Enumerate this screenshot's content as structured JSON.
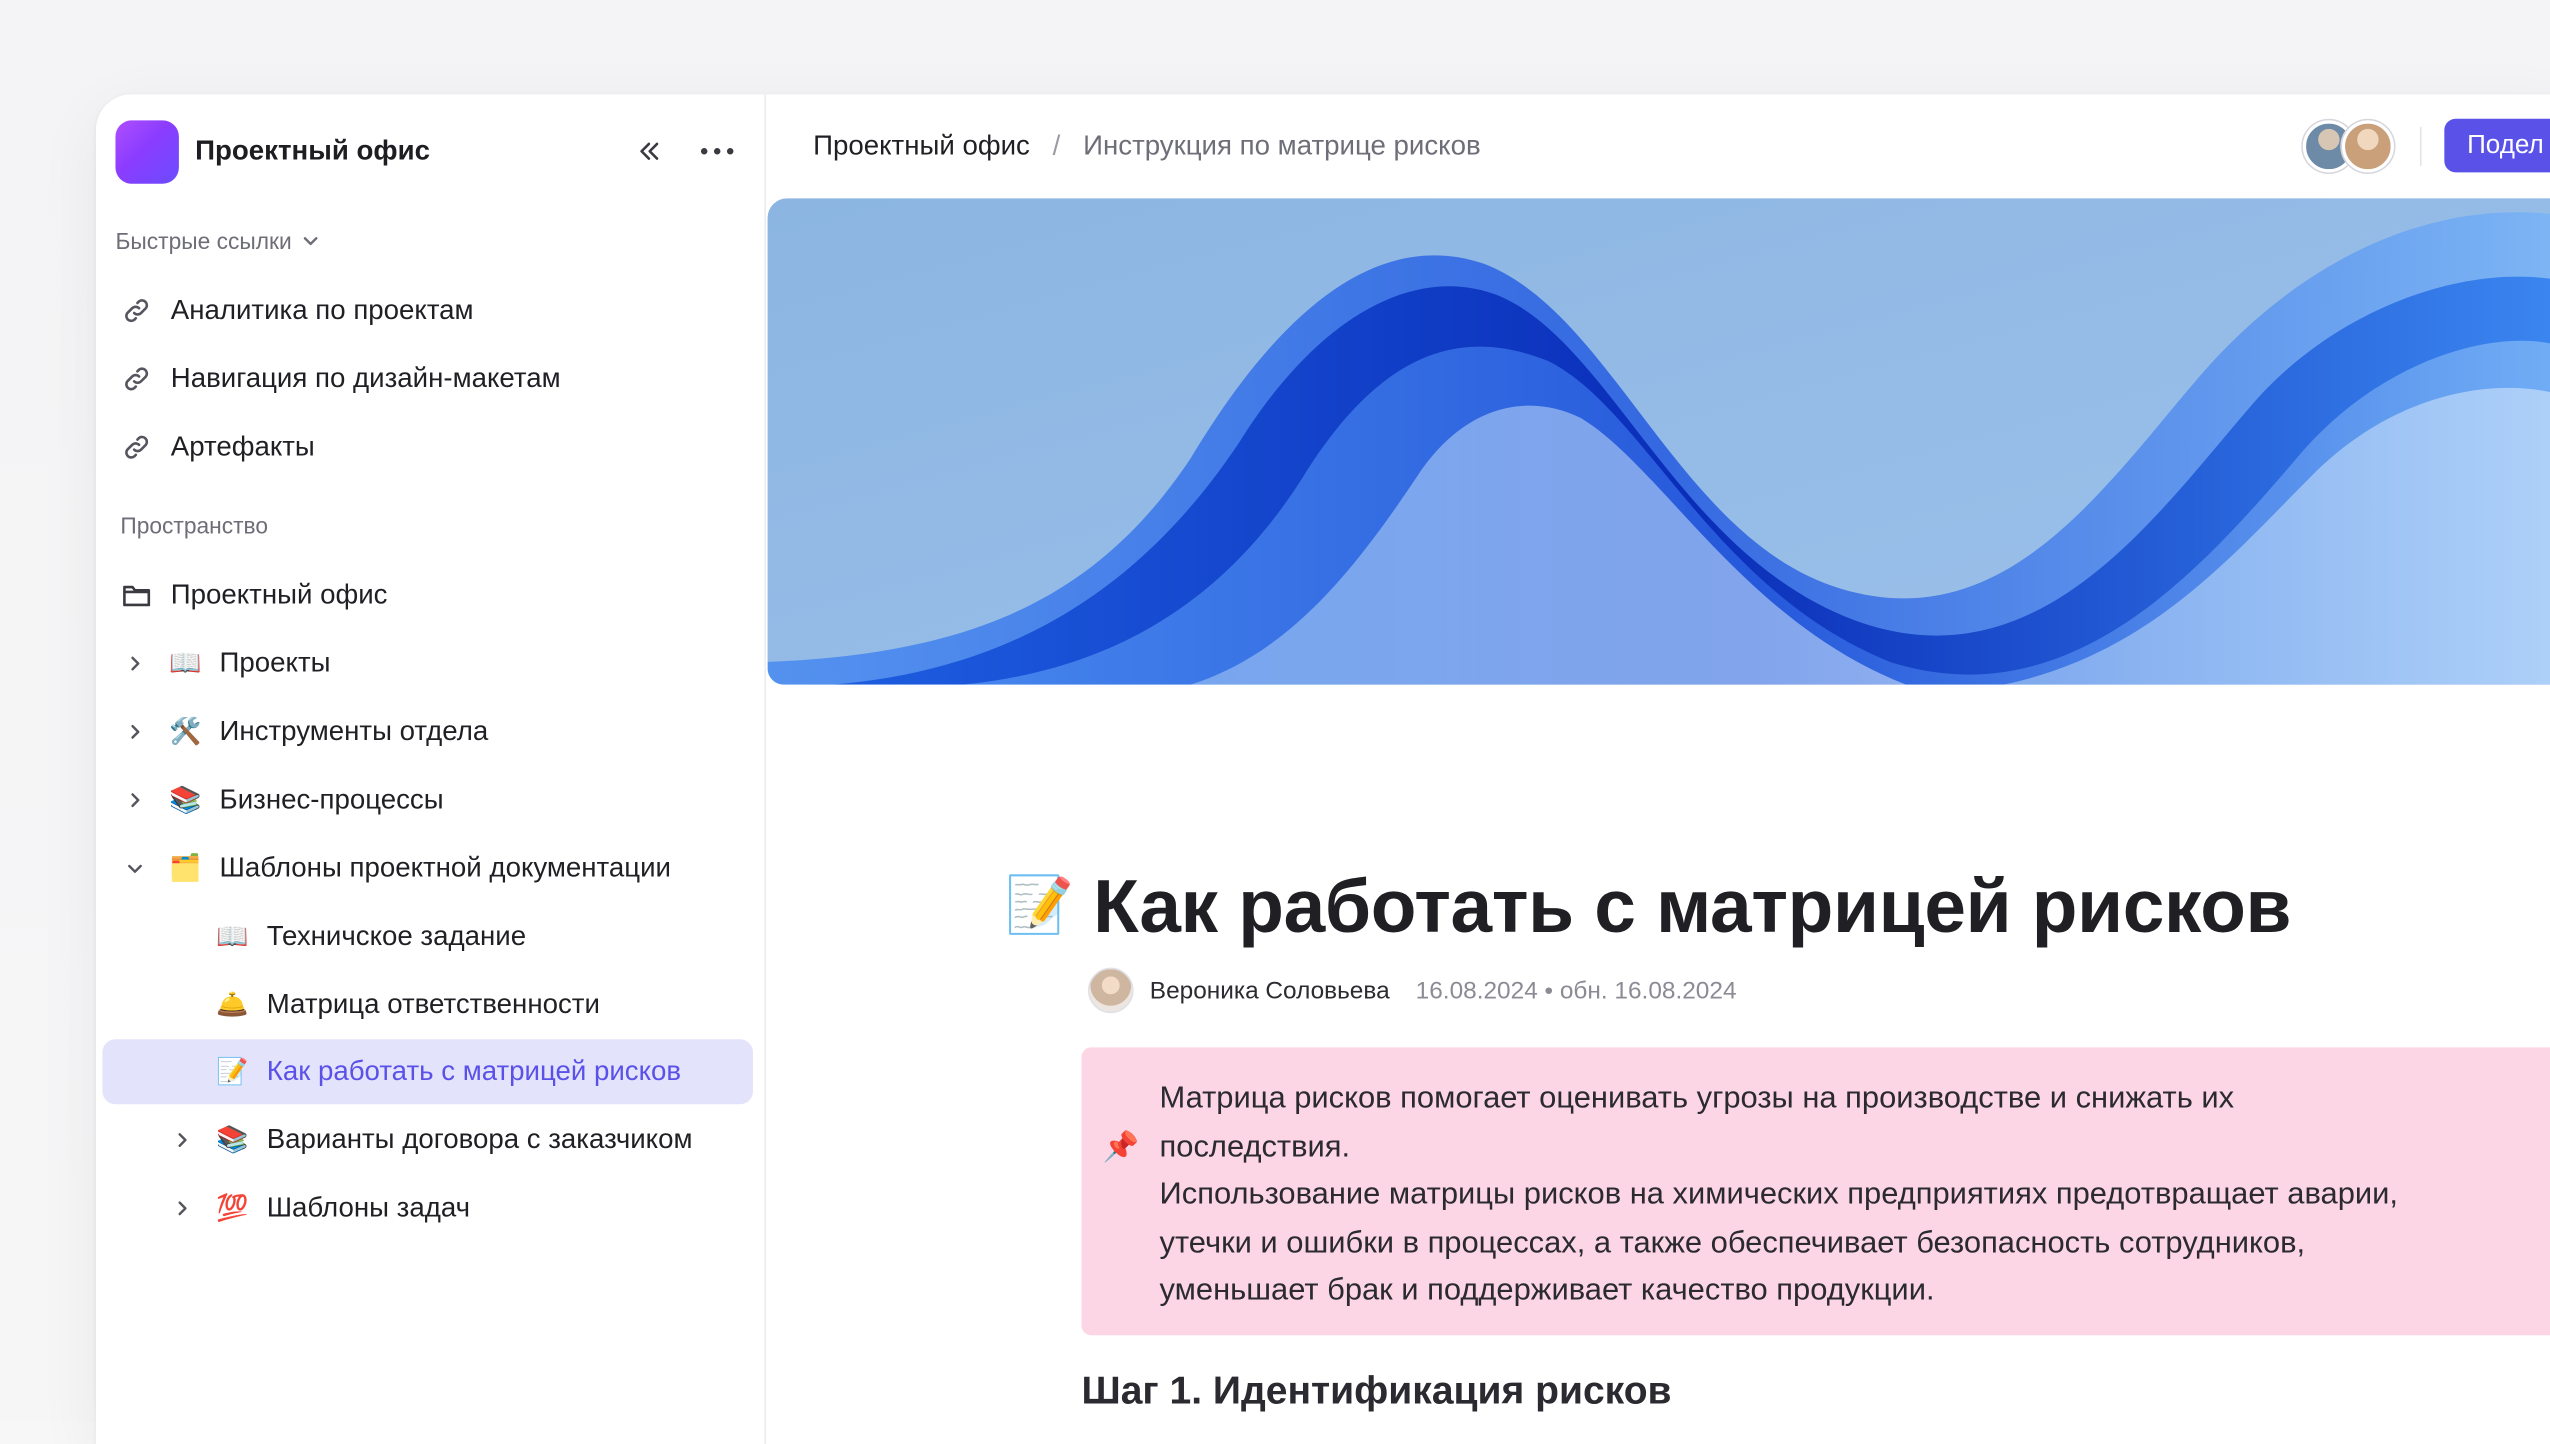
{
  "workspace": {
    "name": "Проектный офис"
  },
  "sidebar": {
    "quick_links_title": "Быстрые ссылки",
    "quick_links": [
      {
        "label": "Аналитика по проектам",
        "icon": "link-icon"
      },
      {
        "label": "Навигация по дизайн-макетам",
        "icon": "link-icon"
      },
      {
        "label": "Артефакты",
        "icon": "link-icon"
      }
    ],
    "space_title": "Пространство",
    "space_root": {
      "label": "Проектный офис",
      "icon": "folder-icon"
    },
    "tree": [
      {
        "label": "Проекты",
        "emoji": "📖",
        "chevron": "right"
      },
      {
        "label": "Инструменты отдела",
        "emoji": "🛠️",
        "chevron": "right"
      },
      {
        "label": "Бизнес-процессы",
        "emoji": "📚",
        "chevron": "right"
      },
      {
        "label": "Шаблоны проектной документации",
        "emoji": "🗂️",
        "chevron": "down"
      },
      {
        "label": "Техничское задание",
        "emoji": "📖",
        "chevron": "none"
      },
      {
        "label": "Матрица ответственности",
        "emoji": "🛎️",
        "chevron": "none"
      },
      {
        "label": "Как работать с матрицей рисков",
        "emoji": "📝",
        "chevron": "none",
        "active": true
      },
      {
        "label": "Варианты договора с заказчиком",
        "emoji": "📚",
        "chevron": "right"
      },
      {
        "label": "Шаблоны задач",
        "emoji": "💯",
        "chevron": "right"
      }
    ]
  },
  "breadcrumb": {
    "root": "Проектный офис",
    "separator": "/",
    "current": "Инструкция по матрице рисков"
  },
  "toolbar": {
    "share_label": "Подел"
  },
  "document": {
    "emoji": "📝",
    "title": "Как работать с матрицей рисков",
    "author": "Вероника Соловьева",
    "dates": "16.08.2024 • обн. 16.08.2024",
    "callout": {
      "emoji": "📌",
      "lines": [
        "Матрица рисков помогает оценивать угрозы на производстве и снижать их",
        "последствия.",
        "Использование матрицы рисков на химических предприятиях предотвращает аварии,",
        "утечки и ошибки в процессах, а также обеспечивает безопасность сотрудников,",
        "уменьшает брак и поддерживает качество продукции."
      ]
    },
    "heading": "Шаг 1. Идентификация рисков"
  },
  "colors": {
    "accent": "#5a51e8",
    "active_item_bg": "#e3e3fb",
    "callout_bg": "#fdd6e5",
    "cover_bg": "#8fb8e3"
  }
}
